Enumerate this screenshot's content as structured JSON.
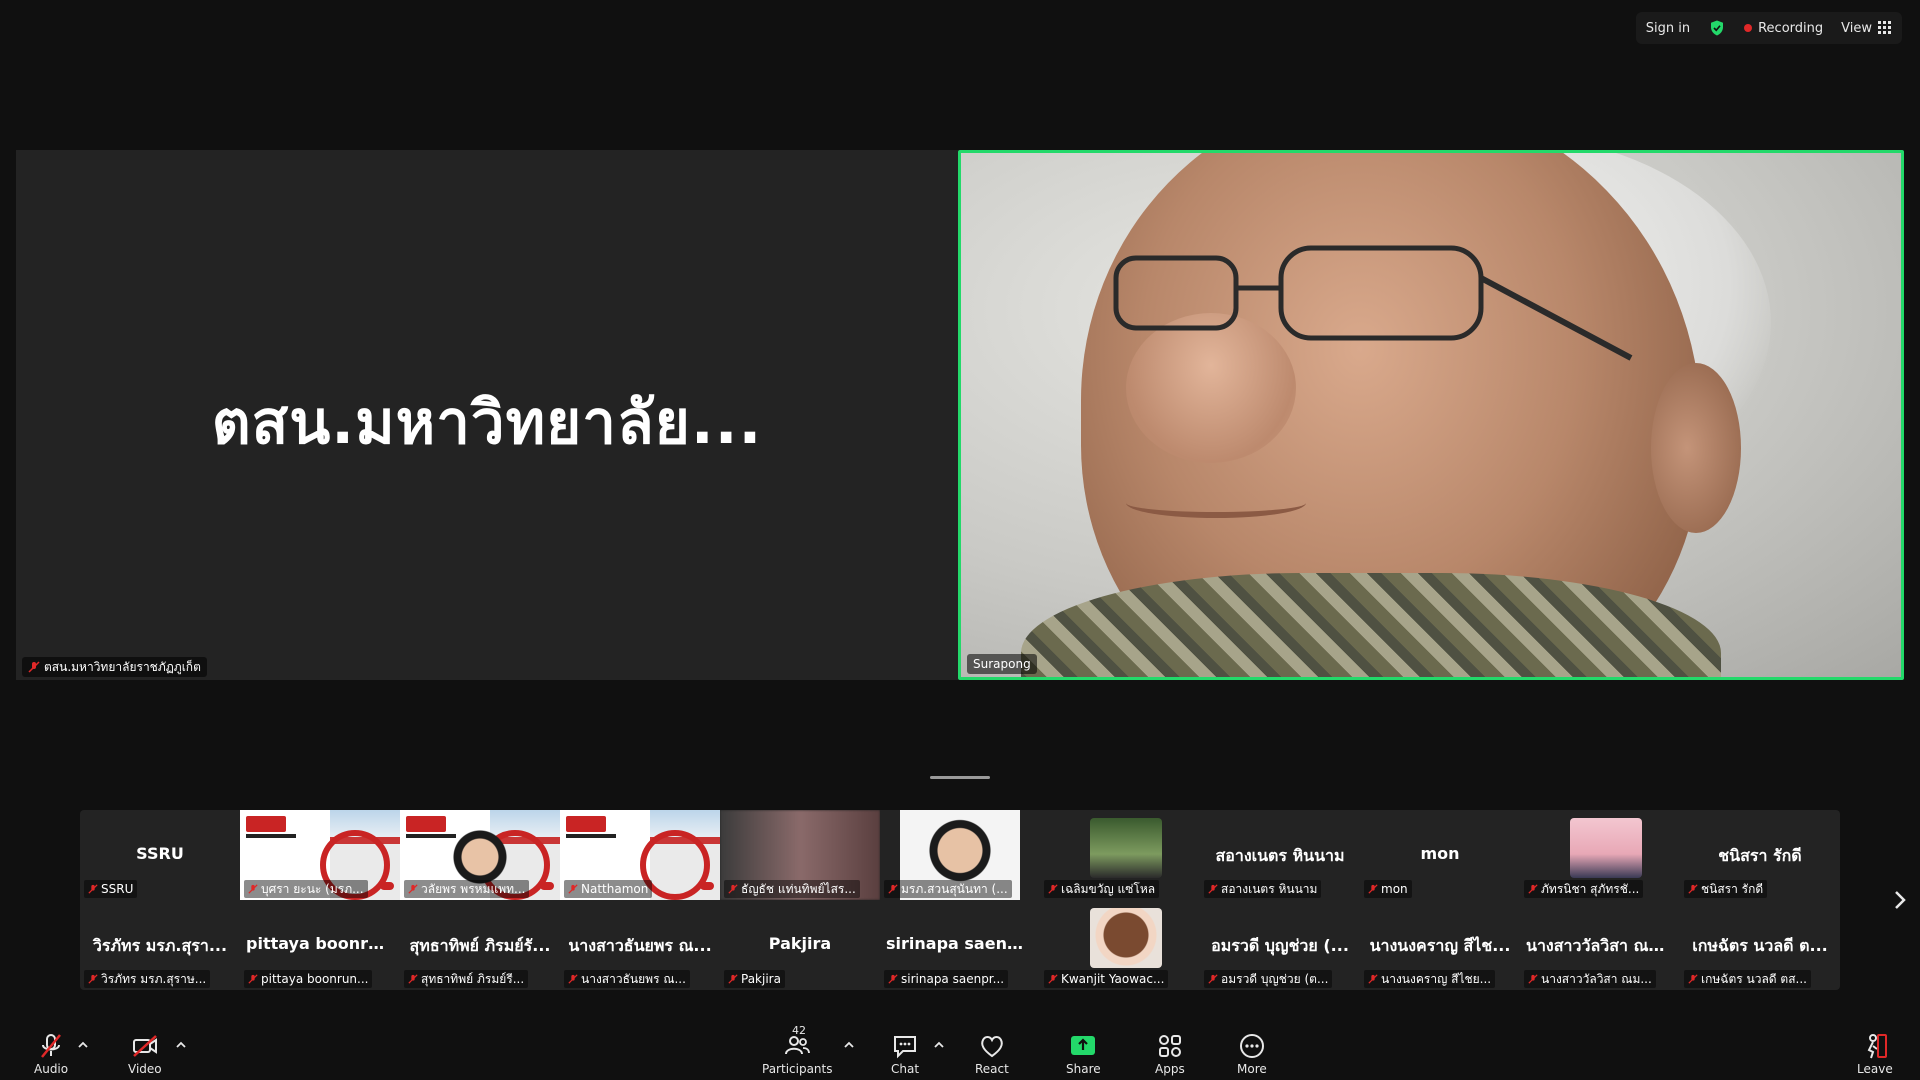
{
  "topbar": {
    "sign_in": "Sign in",
    "recording": "Recording",
    "view": "View",
    "colors": {
      "recording_dot": "#e02828",
      "shield": "#23d96a"
    }
  },
  "main": {
    "left_tile": {
      "big_name": "ตสน.มหาวิทยาลัย...",
      "name_tag": "ตสน.มหาวิทยาลัยราชภัฏภูเก็ต"
    },
    "right_tile": {
      "name_tag": "Surapong",
      "border_color": "#23d96a"
    }
  },
  "gallery": {
    "row1": [
      {
        "type": "name",
        "big": "SSRU",
        "tag": "SSRU"
      },
      {
        "type": "slide",
        "tag": "บุศรา ยะนะ (มรภ..."
      },
      {
        "type": "slide-person",
        "tag": "วลัยพร พรหมแพท..."
      },
      {
        "type": "slide",
        "tag": "Natthamon"
      },
      {
        "type": "blurry",
        "tag": "ธัญธัช แท่นทิพย์ไสร..."
      },
      {
        "type": "photo-woman",
        "tag": "มรภ.สวนสุนันทา (..."
      },
      {
        "type": "photo-green",
        "tag": "เฉลิมขวัญ แซ่โหล"
      },
      {
        "type": "name",
        "big": "สอางเนตร หินนาม",
        "tag": "สอางเนตร หินนาม"
      },
      {
        "type": "name",
        "big": "mon",
        "tag": "mon"
      },
      {
        "type": "photo-pink",
        "tag": "ภัทรนิชา สุภัทรชั..."
      },
      {
        "type": "name",
        "big": "ชนิสรา รักดี",
        "tag": "ชนิสรา รักดี"
      }
    ],
    "row2": [
      {
        "type": "name",
        "big": "วิรภัทร มรภ.สุรา...",
        "tag": "วิรภัทร มรภ.สุราษ..."
      },
      {
        "type": "name",
        "big": "pittaya boonrun...",
        "tag": "pittaya boonrun..."
      },
      {
        "type": "name",
        "big": "สุทธาทิพย์ ภิรมย์รั...",
        "tag": "สุทธาทิพย์ ภิรมย์รี..."
      },
      {
        "type": "name",
        "big": "นางสาวธันยพร ณ...",
        "tag": "นางสาวธันยพร ณ..."
      },
      {
        "type": "name",
        "big": "Pakjira",
        "tag": "Pakjira"
      },
      {
        "type": "name",
        "big": "sirinapa saenpr...",
        "tag": "sirinapa saenpr..."
      },
      {
        "type": "photo-doll",
        "tag": "Kwanjit Yaowac..."
      },
      {
        "type": "name",
        "big": "อมรวดี บุญช่วย (...",
        "tag": "อมรวดี บุญช่วย (ต..."
      },
      {
        "type": "name",
        "big": "นางนงคราญ สีไช...",
        "tag": "นางนงคราญ สีไชย..."
      },
      {
        "type": "name",
        "big": "นางสาววัลวิสา ณม...",
        "tag": "นางสาววัลวิสา ณม..."
      },
      {
        "type": "name",
        "big": "เกษฉัตร นวลดี ต...",
        "tag": "เกษฉัตร นวลดี ตส..."
      }
    ]
  },
  "toolbar": {
    "audio": "Audio",
    "video": "Video",
    "participants": "Participants",
    "participants_count": "42",
    "chat": "Chat",
    "react": "React",
    "share": "Share",
    "apps": "Apps",
    "more": "More",
    "leave": "Leave",
    "colors": {
      "share": "#23d96a",
      "muted": "#e02828",
      "leave": "#e02828"
    }
  }
}
